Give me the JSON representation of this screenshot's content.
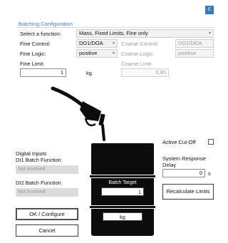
{
  "window": {
    "title": "Batching Configuration",
    "corner_label": "E"
  },
  "function_select": {
    "label": "Select a function:",
    "value": "Mass, Fixed Limits, Fine only"
  },
  "fine": {
    "control_label": "Fine Control:",
    "control_value": "DO1/DOA",
    "logic_label": "Fine Logic:",
    "logic_value": "positive",
    "limit_label": "Fine Limit",
    "limit_value": "1",
    "unit": "kg"
  },
  "coarse": {
    "control_label": "Coarse Control:",
    "control_value": "DO1/DOA",
    "logic_label": "Coarse Logic:",
    "logic_value": "positive",
    "limit_label": "Coarse Limit",
    "limit_value": "0,95"
  },
  "digital_inputs": {
    "heading": "Digital Inputs",
    "di1_label": "DI1 Batch Function",
    "di1_value": "Not involved",
    "di2_label": "DI2 Batch Function",
    "di2_value": "Not involved"
  },
  "buttons": {
    "ok": "OK / Configure",
    "cancel": "Cancel",
    "recalculate": "Recalculate Limits"
  },
  "batch": {
    "target_label": "Batch Target",
    "target_value": "1",
    "unit": "kg"
  },
  "cutoff": {
    "label": "Active Cut-Off",
    "checked": false,
    "delay_label_1": "System Response",
    "delay_label_2": "Delay",
    "delay_value": "0",
    "delay_unit": "s"
  },
  "icons": {
    "nozzle": "fuel-nozzle-icon",
    "dropdown": "chevron-down-icon"
  },
  "colors": {
    "accent": "#3f7dc0",
    "tank": "#0c0c0c",
    "field_disabled": "#dcdcdc"
  }
}
